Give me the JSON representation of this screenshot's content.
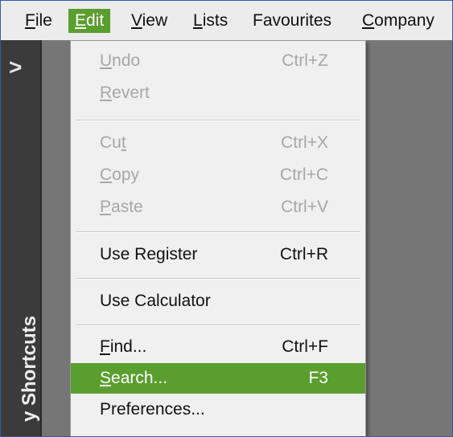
{
  "menubar": {
    "items": [
      {
        "pre": "",
        "mnemonic": "F",
        "post": "ile"
      },
      {
        "pre": "",
        "mnemonic": "E",
        "post": "dit"
      },
      {
        "pre": "",
        "mnemonic": "V",
        "post": "iew"
      },
      {
        "pre": "",
        "mnemonic": "L",
        "post": "ists"
      },
      {
        "pre": "Favourites",
        "mnemonic": "",
        "post": ""
      },
      {
        "pre": "",
        "mnemonic": "C",
        "post": "ompany"
      }
    ],
    "active_item": "Edit"
  },
  "sidebar": {
    "toggle_glyph": ">",
    "label": "y Shortcuts"
  },
  "edit_menu": {
    "items": [
      {
        "pre": "",
        "mnemonic": "U",
        "post": "ndo",
        "shortcut": "Ctrl+Z",
        "enabled": false
      },
      {
        "pre": "",
        "mnemonic": "R",
        "post": "evert",
        "shortcut": "",
        "enabled": false
      },
      {
        "pre": "Cu",
        "mnemonic": "t",
        "post": "",
        "shortcut": "Ctrl+X",
        "enabled": false
      },
      {
        "pre": "",
        "mnemonic": "C",
        "post": "opy",
        "shortcut": "Ctrl+C",
        "enabled": false
      },
      {
        "pre": "",
        "mnemonic": "P",
        "post": "aste",
        "shortcut": "Ctrl+V",
        "enabled": false
      },
      {
        "pre": "Use Register",
        "mnemonic": "",
        "post": "",
        "shortcut": "Ctrl+R",
        "enabled": true
      },
      {
        "pre": "Use Calculator",
        "mnemonic": "",
        "post": "",
        "shortcut": "",
        "enabled": true
      },
      {
        "pre": "",
        "mnemonic": "F",
        "post": "ind...",
        "shortcut": "Ctrl+F",
        "enabled": true
      },
      {
        "pre": "",
        "mnemonic": "S",
        "post": "earch...",
        "shortcut": "F3",
        "enabled": true,
        "highlighted": true
      },
      {
        "pre": "Preferences...",
        "mnemonic": "",
        "post": "",
        "shortcut": "",
        "enabled": true
      }
    ]
  },
  "colors": {
    "accent_green": "#5a9e2f",
    "disabled_text": "#a7a7a7",
    "sidebar_bg": "#3b3b3b",
    "workspace_bg": "#767676"
  }
}
